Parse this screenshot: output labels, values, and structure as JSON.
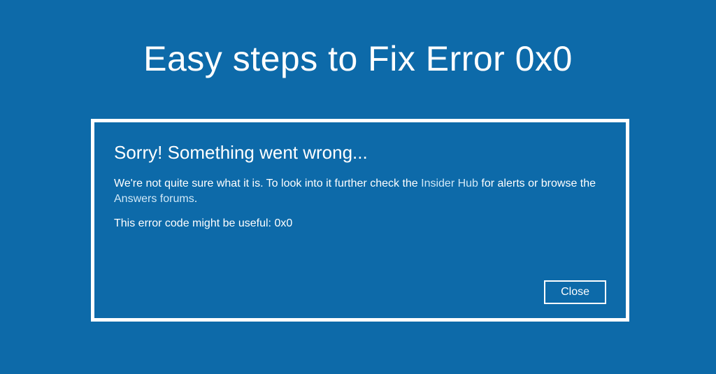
{
  "page": {
    "title": "Easy steps to Fix Error 0x0"
  },
  "dialog": {
    "title": "Sorry! Something went wrong...",
    "body_prefix": "We're not quite sure what it is. To look into it further check the ",
    "link1": "Insider Hub",
    "body_mid": " for alerts or browse the ",
    "link2": "Answers forums",
    "body_suffix": ".",
    "errcode": "This error code might be useful: 0x0",
    "close_label": "Close"
  },
  "colors": {
    "background": "#0d6aa9",
    "border": "#ffffff",
    "text": "#ffffff"
  }
}
